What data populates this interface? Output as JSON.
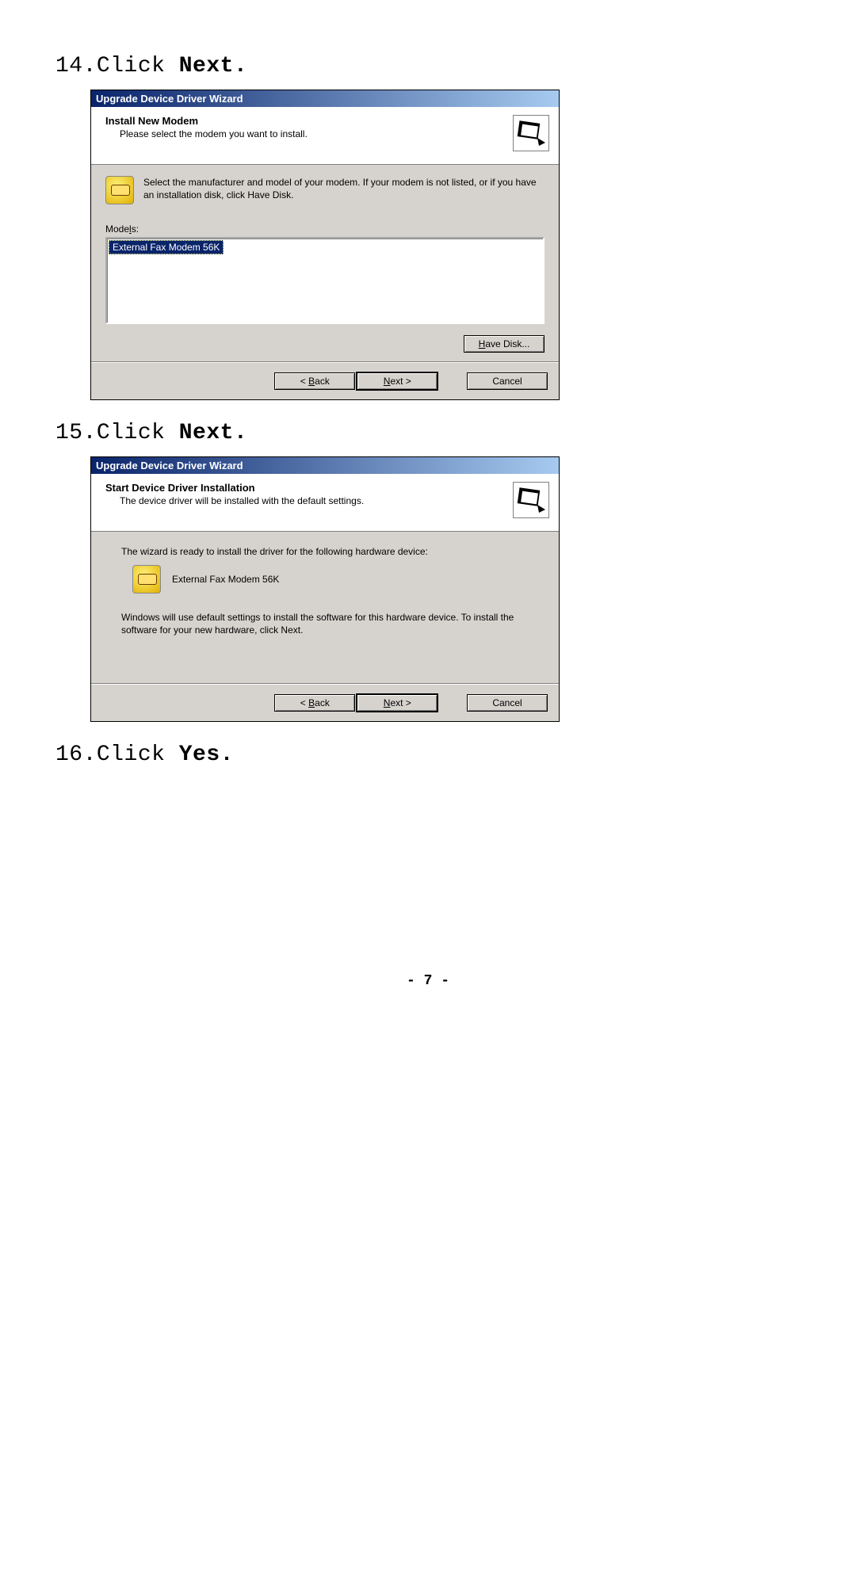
{
  "steps": {
    "s14_prefix": "14.Click ",
    "s14_action": "Next",
    "s15_prefix": "15.Click ",
    "s15_action": "Next",
    "s16_prefix": "16.Click ",
    "s16_action": "Yes",
    "period": "."
  },
  "wizard1": {
    "title": "Upgrade Device Driver Wizard",
    "header_title": "Install New Modem",
    "header_sub": "Please select the modem you want to install.",
    "body_text": "Select the manufacturer and model of your modem. If your modem is not listed, or if you have an installation disk, click Have Disk.",
    "models_label_pre": "Mode",
    "models_label_u": "l",
    "models_label_post": "s:",
    "model_item": "External Fax Modem 56K",
    "have_disk_u": "H",
    "have_disk_rest": "ave Disk...",
    "back_lt": "< ",
    "back_u": "B",
    "back_rest": "ack",
    "next_u": "N",
    "next_rest": "ext >",
    "cancel": "Cancel"
  },
  "wizard2": {
    "title": "Upgrade Device Driver Wizard",
    "header_title": "Start Device Driver Installation",
    "header_sub": "The device driver will be installed with the default settings.",
    "line1": "The wizard is ready to install the driver for the following hardware device:",
    "device": "External Fax Modem 56K",
    "note": "Windows will use default settings to install the software for this hardware device. To install the software for your new hardware, click Next.",
    "back_lt": "< ",
    "back_u": "B",
    "back_rest": "ack",
    "next_u": "N",
    "next_rest": "ext >",
    "cancel": "Cancel"
  },
  "page_number": "- 7 -"
}
